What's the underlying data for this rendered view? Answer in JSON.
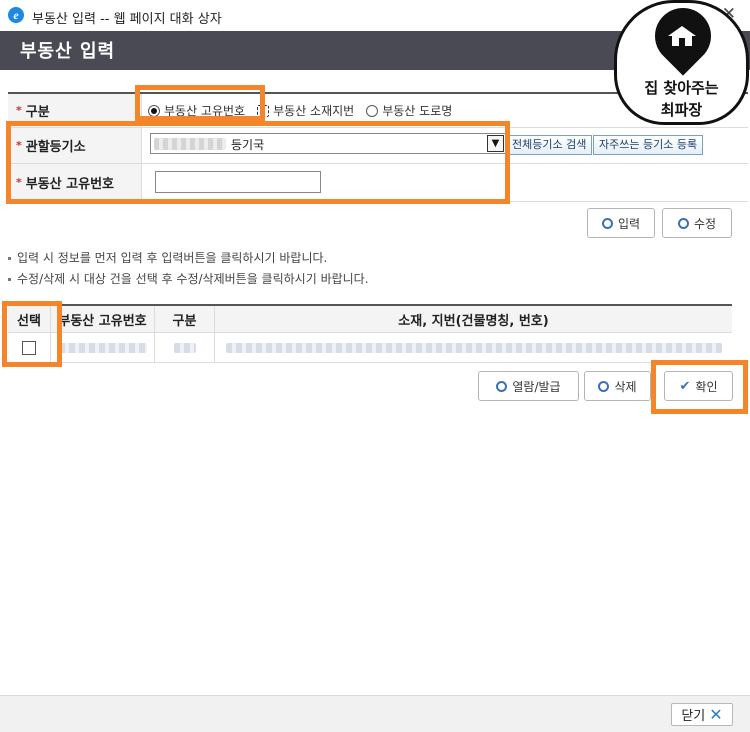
{
  "window": {
    "title": "부동산 입력 -- 웹 페이지 대화 상자",
    "close_symbol": "✕"
  },
  "page": {
    "title": "부동산 입력"
  },
  "form": {
    "type_label": "구분",
    "required_mark": "*",
    "radio_options": [
      {
        "label": "부동산 고유번호",
        "selected": true
      },
      {
        "label": "부동산 소재지번",
        "selected": false
      },
      {
        "label": "부동산 도로명",
        "selected": false
      }
    ],
    "registry_label": "관할등기소",
    "registry_value_suffix": "등기국",
    "search_all_button": "전체등기소 검색",
    "register_favorite_button": "자주쓰는 등기소 등록",
    "unique_number_label": "부동산 고유번호",
    "unique_number_value": ""
  },
  "actions": {
    "input_button": "입력",
    "edit_button": "수정"
  },
  "notes": [
    "입력 시 정보를 먼저 입력 후 입력버튼을 클릭하시기 바랍니다.",
    "수정/삭제 시 대상 건을 선택 후 수정/삭제버튼을 클릭하시기 바랍니다."
  ],
  "table": {
    "columns": [
      "선택",
      "부동산 고유번호",
      "구분",
      "소재, 지번(건물명칭, 번호)"
    ]
  },
  "bottom_actions": {
    "view_issue_button": "열람/발급",
    "delete_button": "삭제",
    "confirm_button": "확인"
  },
  "footer": {
    "close_button": "닫기",
    "close_symbol": "✕"
  },
  "logo": {
    "line1": "집 찾아주는",
    "line2": "최파장"
  },
  "colors": {
    "highlight": "#f4852a",
    "header_bg": "#4a4a55",
    "accent": "#3b6fb6"
  }
}
